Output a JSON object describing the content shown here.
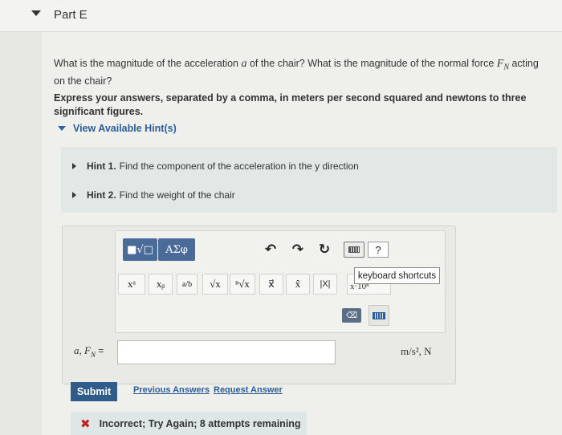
{
  "part": {
    "title": "Part E"
  },
  "question": {
    "text_a": "What is the magnitude of the acceleration ",
    "var_a": "a",
    "text_b": " of the chair? What is the magnitude of the normal force ",
    "var_f": "F",
    "var_f_sub": "N",
    "text_c": " acting on the chair?"
  },
  "instruction": "Express your answers, separated by a comma, in meters per second squared and newtons to three significant figures.",
  "hints": {
    "toggle_label": "View Available Hint(s)",
    "items": [
      {
        "number": "Hint 1.",
        "text": "Find the component of the acceleration in the y direction"
      },
      {
        "number": "Hint 2.",
        "text": "Find the weight of the chair"
      }
    ]
  },
  "toolbar": {
    "template_label": "■√□",
    "greek_label": "ΑΣφ",
    "undo": "↶",
    "redo": "↷",
    "reset": "↻",
    "help": "?",
    "tooltip": "keyboard shortcuts"
  },
  "symbols": {
    "power": "xᵃ",
    "subscript": "xᵦ",
    "fraction": "a/b",
    "sqrt": "√x",
    "nroot": "ⁿ√x",
    "vector": "x⃗",
    "hat": "x̂",
    "abs": "|X|",
    "sci": "x·10ⁿ"
  },
  "answer": {
    "label": "a, F",
    "label_sub": "N",
    "label_eq": " =",
    "value": "",
    "units": "m/s², N"
  },
  "actions": {
    "submit": "Submit",
    "previous": "Previous Answers",
    "request": "Request Answer"
  },
  "feedback": {
    "text": "Incorrect; Try Again; 8 attempts remaining"
  }
}
